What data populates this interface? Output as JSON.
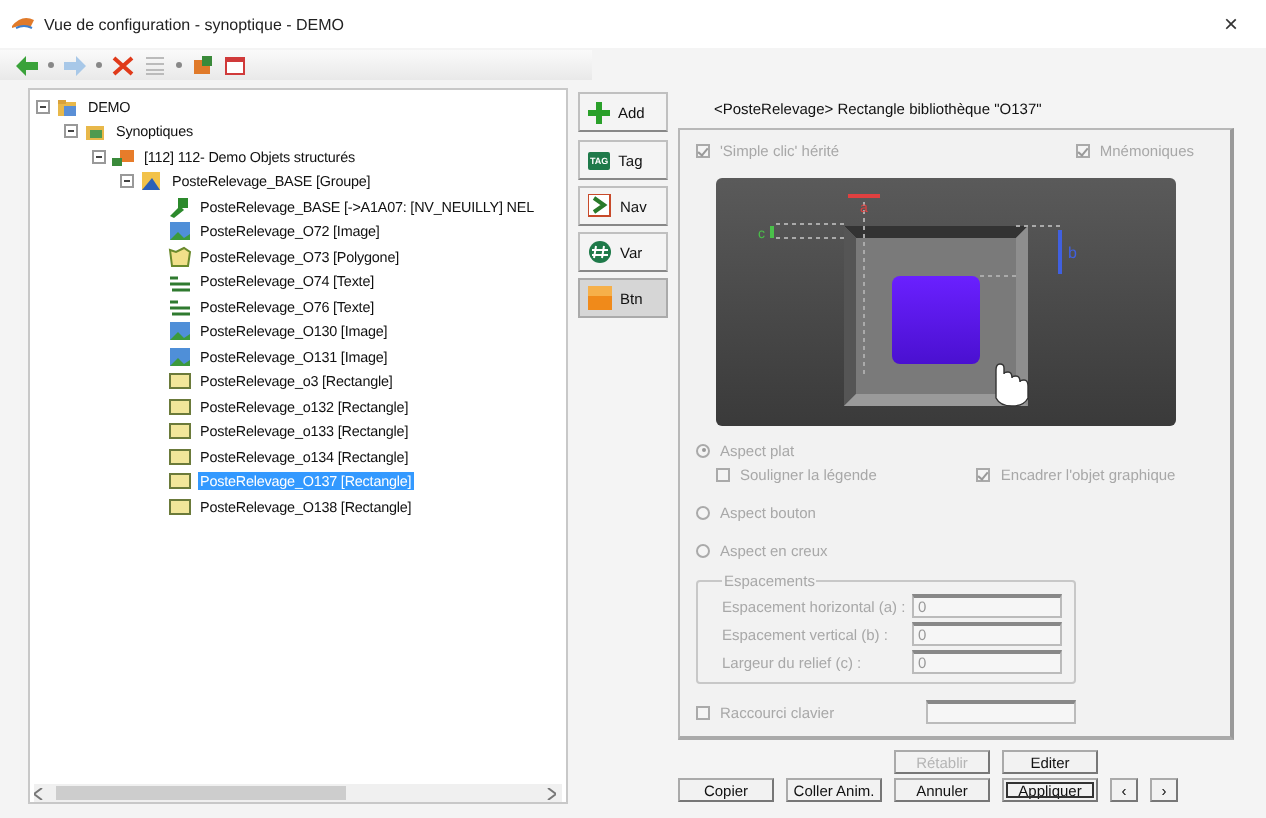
{
  "window": {
    "title": "Vue de configuration - synoptique - DEMO",
    "close": "×"
  },
  "tree": [
    {
      "label": "DEMO",
      "kind": "project",
      "expanded": true,
      "selected": false,
      "children": [
        {
          "label": "Synoptiques",
          "kind": "folder",
          "expanded": true,
          "selected": false,
          "children": [
            {
              "label": "[112]  112- Demo Objets structurés",
              "kind": "synoptic",
              "expanded": true,
              "selected": false,
              "children": [
                {
                  "label": "PosteRelevage_BASE [Groupe]",
                  "kind": "group",
                  "expanded": true,
                  "selected": false,
                  "children": [
                    {
                      "label": "PosteRelevage_BASE [->A1A07: [NV_NEUILLY] NEL",
                      "kind": "link",
                      "selected": false
                    },
                    {
                      "label": "PosteRelevage_O72 [Image]",
                      "kind": "image",
                      "selected": false
                    },
                    {
                      "label": "PosteRelevage_O73 [Polygone]",
                      "kind": "polygon",
                      "selected": false
                    },
                    {
                      "label": "PosteRelevage_O74 [Texte]",
                      "kind": "text",
                      "selected": false
                    },
                    {
                      "label": "PosteRelevage_O76 [Texte]",
                      "kind": "text",
                      "selected": false
                    },
                    {
                      "label": "PosteRelevage_O130 [Image]",
                      "kind": "image",
                      "selected": false
                    },
                    {
                      "label": "PosteRelevage_O131 [Image]",
                      "kind": "image",
                      "selected": false
                    },
                    {
                      "label": "PosteRelevage_o3 [Rectangle]",
                      "kind": "rect",
                      "selected": false
                    },
                    {
                      "label": "PosteRelevage_o132 [Rectangle]",
                      "kind": "rect",
                      "selected": false
                    },
                    {
                      "label": "PosteRelevage_o133 [Rectangle]",
                      "kind": "rect",
                      "selected": false
                    },
                    {
                      "label": "PosteRelevage_o134 [Rectangle]",
                      "kind": "rect",
                      "selected": false
                    },
                    {
                      "label": "PosteRelevage_O137 [Rectangle]",
                      "kind": "rect",
                      "selected": true
                    },
                    {
                      "label": "PosteRelevage_O138 [Rectangle]",
                      "kind": "rect",
                      "selected": false
                    }
                  ]
                }
              ]
            }
          ]
        }
      ]
    }
  ],
  "add_button": "Add",
  "tabs": [
    {
      "label": "Tag",
      "kind": "tag",
      "badge": "TAG",
      "selected": false
    },
    {
      "label": "Nav",
      "kind": "nav",
      "selected": false
    },
    {
      "label": "Var",
      "kind": "var",
      "selected": false
    },
    {
      "label": "Btn",
      "kind": "btn",
      "selected": true
    }
  ],
  "panel": {
    "header": "<PosteRelevage> Rectangle bibliothèque  \"O137\"",
    "flags": [
      {
        "label": "'Simple clic' hérité",
        "checked": true,
        "disabled": true
      },
      {
        "label": "Mnémoniques",
        "checked": true,
        "disabled": true
      }
    ],
    "preview": {
      "a_label": "a",
      "b_label": "b",
      "c_label": "c"
    },
    "aspects": [
      {
        "label": "Aspect plat",
        "selected": true,
        "disabled": true,
        "options": [
          {
            "label": "Souligner la légende",
            "checked": false,
            "disabled": true
          },
          {
            "label": "Encadrer l'objet graphique",
            "checked": true,
            "disabled": true
          }
        ]
      },
      {
        "label": "Aspect bouton",
        "selected": false,
        "disabled": true
      },
      {
        "label": "Aspect en creux",
        "selected": false,
        "disabled": true
      }
    ],
    "spacing": {
      "title": "Espacements",
      "disabled": true,
      "fields": [
        {
          "label": "Espacement horizontal (a) :",
          "value": "0"
        },
        {
          "label": "Espacement vertical (b) :",
          "value": "0"
        },
        {
          "label": "Largeur du relief (c) :",
          "value": "0"
        }
      ]
    },
    "shortcut": {
      "label": "Raccourci clavier",
      "checked": false,
      "disabled": true
    }
  },
  "top_buttons": [
    {
      "label": "Rétablir",
      "disabled": true
    },
    {
      "label": "Editer",
      "disabled": false
    }
  ],
  "bottom_buttons": [
    {
      "label": "Copier",
      "kind": "wide"
    },
    {
      "label": "Coller Anim.",
      "kind": "wide"
    },
    {
      "label": "Annuler",
      "kind": "wide"
    },
    {
      "label": "Appliquer",
      "kind": "default"
    },
    {
      "label": "‹",
      "kind": "small"
    },
    {
      "label": "›",
      "kind": "small"
    }
  ]
}
